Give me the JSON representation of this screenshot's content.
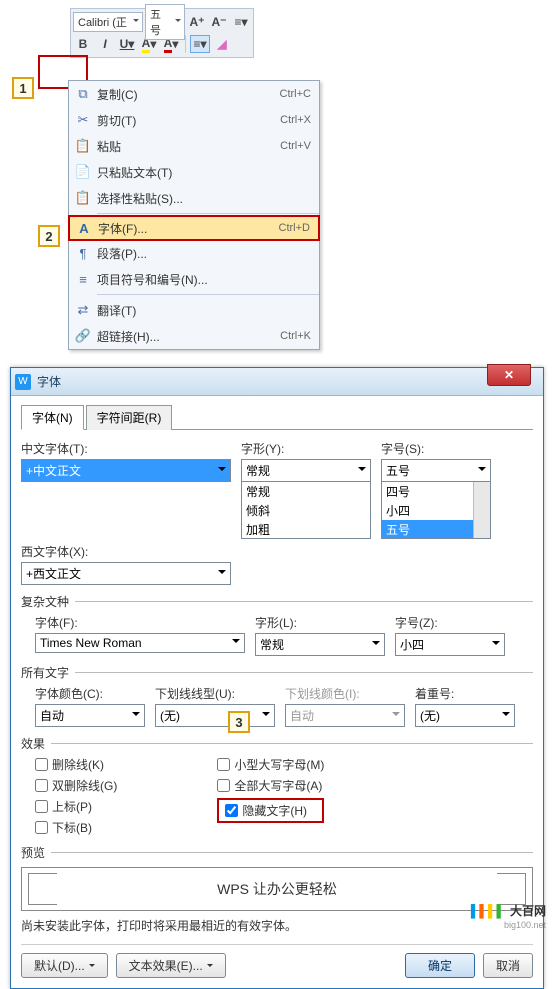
{
  "toolbar": {
    "font_name": "Calibri (正",
    "font_size": "五号",
    "inc_A": "A⁺",
    "dec_A": "A⁻"
  },
  "context_menu": {
    "items": [
      {
        "icon": "⧉",
        "label": "复制(C)",
        "shortcut": "Ctrl+C"
      },
      {
        "icon": "✂",
        "label": "剪切(T)",
        "shortcut": "Ctrl+X"
      },
      {
        "icon": "📋",
        "label": "粘贴",
        "shortcut": "Ctrl+V"
      },
      {
        "icon": "📄",
        "label": "只粘贴文本(T)",
        "shortcut": ""
      },
      {
        "icon": "📋",
        "label": "选择性粘贴(S)...",
        "shortcut": ""
      },
      {
        "icon": "A",
        "label": "字体(F)...",
        "shortcut": "Ctrl+D",
        "highlight": true
      },
      {
        "icon": "¶",
        "label": "段落(P)...",
        "shortcut": ""
      },
      {
        "icon": "≡",
        "label": "项目符号和编号(N)...",
        "shortcut": ""
      },
      {
        "icon": "⇄",
        "label": "翻译(T)",
        "shortcut": ""
      },
      {
        "icon": "🔗",
        "label": "超链接(H)...",
        "shortcut": "Ctrl+K"
      }
    ]
  },
  "dialog": {
    "title": "字体",
    "tabs": [
      "字体(N)",
      "字符间距(R)"
    ],
    "chinese_font": {
      "label": "中文字体(T):",
      "value": "+中文正文"
    },
    "western_font": {
      "label": "西文字体(X):",
      "value": "+西文正文"
    },
    "style": {
      "label": "字形(Y):",
      "value": "常规",
      "options": [
        "常规",
        "倾斜",
        "加粗"
      ]
    },
    "size": {
      "label": "字号(S):",
      "value": "五号",
      "options": [
        "四号",
        "小四",
        "五号"
      ]
    },
    "complex_header": "复杂文种",
    "complex_font": {
      "label": "字体(F):",
      "value": "Times New Roman"
    },
    "complex_style": {
      "label": "字形(L):",
      "value": "常规"
    },
    "complex_size": {
      "label": "字号(Z):",
      "value": "小四"
    },
    "all_text_header": "所有文字",
    "font_color": {
      "label": "字体颜色(C):",
      "value": "自动"
    },
    "underline": {
      "label": "下划线线型(U):",
      "value": "(无)"
    },
    "underline_color": {
      "label": "下划线颜色(I):",
      "value": "自动"
    },
    "emphasis": {
      "label": "着重号:",
      "value": "(无)"
    },
    "effects_header": "效果",
    "effects_left": [
      {
        "label": "删除线(K)",
        "checked": false
      },
      {
        "label": "双删除线(G)",
        "checked": false
      },
      {
        "label": "上标(P)",
        "checked": false
      },
      {
        "label": "下标(B)",
        "checked": false
      }
    ],
    "effects_right": [
      {
        "label": "小型大写字母(M)",
        "checked": false
      },
      {
        "label": "全部大写字母(A)",
        "checked": false
      },
      {
        "label": "隐藏文字(H)",
        "checked": true,
        "highlight": true
      }
    ],
    "preview_header": "预览",
    "preview_text": "WPS 让办公更轻松",
    "note": "尚未安装此字体，打印时将采用最相近的有效字体。",
    "buttons": {
      "default": "默认(D)...",
      "text_effect": "文本效果(E)...",
      "ok": "确定",
      "cancel": "取消"
    }
  },
  "steps": {
    "s1": "1",
    "s2": "2",
    "s3": "3"
  },
  "watermark": {
    "brand": "大百网",
    "url": "big100.net"
  }
}
